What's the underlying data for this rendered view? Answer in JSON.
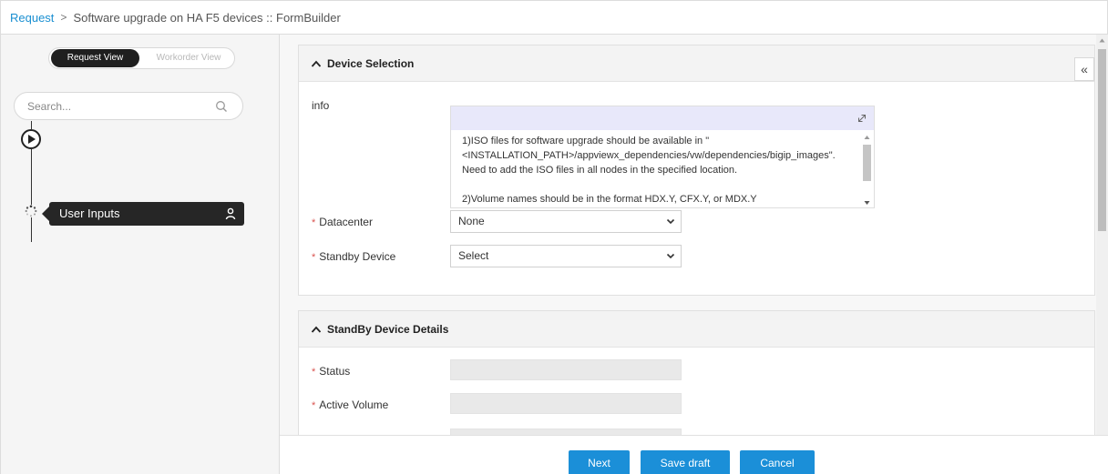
{
  "breadcrumb": {
    "root": "Request",
    "separator": ">",
    "current": "Software upgrade on HA F5 devices :: FormBuilder"
  },
  "sidebar": {
    "view_toggle": {
      "active": "Request View",
      "inactive": "Workorder View"
    },
    "search": {
      "placeholder": "Search...",
      "value": ""
    },
    "workflow_steps": [
      {
        "label": "User Inputs",
        "icon": "person-icon"
      }
    ]
  },
  "device_selection": {
    "title": "Device Selection",
    "info": {
      "label": "info",
      "paragraphs": [
        "1)ISO files for software upgrade should be available in \"<INSTALLATION_PATH>/appviewx_dependencies/vw/dependencies/bigip_images\". Need to add the ISO files in all nodes in the specified location.",
        "2)Volume names should be in the format HDX.Y, CFX.Y, or MDX.Y"
      ]
    },
    "datacenter": {
      "label": "Datacenter",
      "value": "None"
    },
    "standby_device": {
      "label": "Standby Device",
      "value": "Select"
    }
  },
  "standby_details": {
    "title": "StandBy Device Details",
    "status": {
      "label": "Status",
      "value": ""
    },
    "active_volume": {
      "label": "Active Volume",
      "value": ""
    }
  },
  "footer": {
    "next": "Next",
    "save_draft": "Save draft",
    "cancel": "Cancel"
  },
  "colors": {
    "primary": "#1b8fd8",
    "link": "#1a8fd1",
    "required": "#d9534f",
    "dark_pill": "#262626"
  },
  "icons": [
    "search-icon",
    "play-icon",
    "spinner-icon",
    "person-icon",
    "caret-up-icon",
    "chevron-down-icon",
    "expand-icon",
    "double-chevron-left-icon"
  ]
}
